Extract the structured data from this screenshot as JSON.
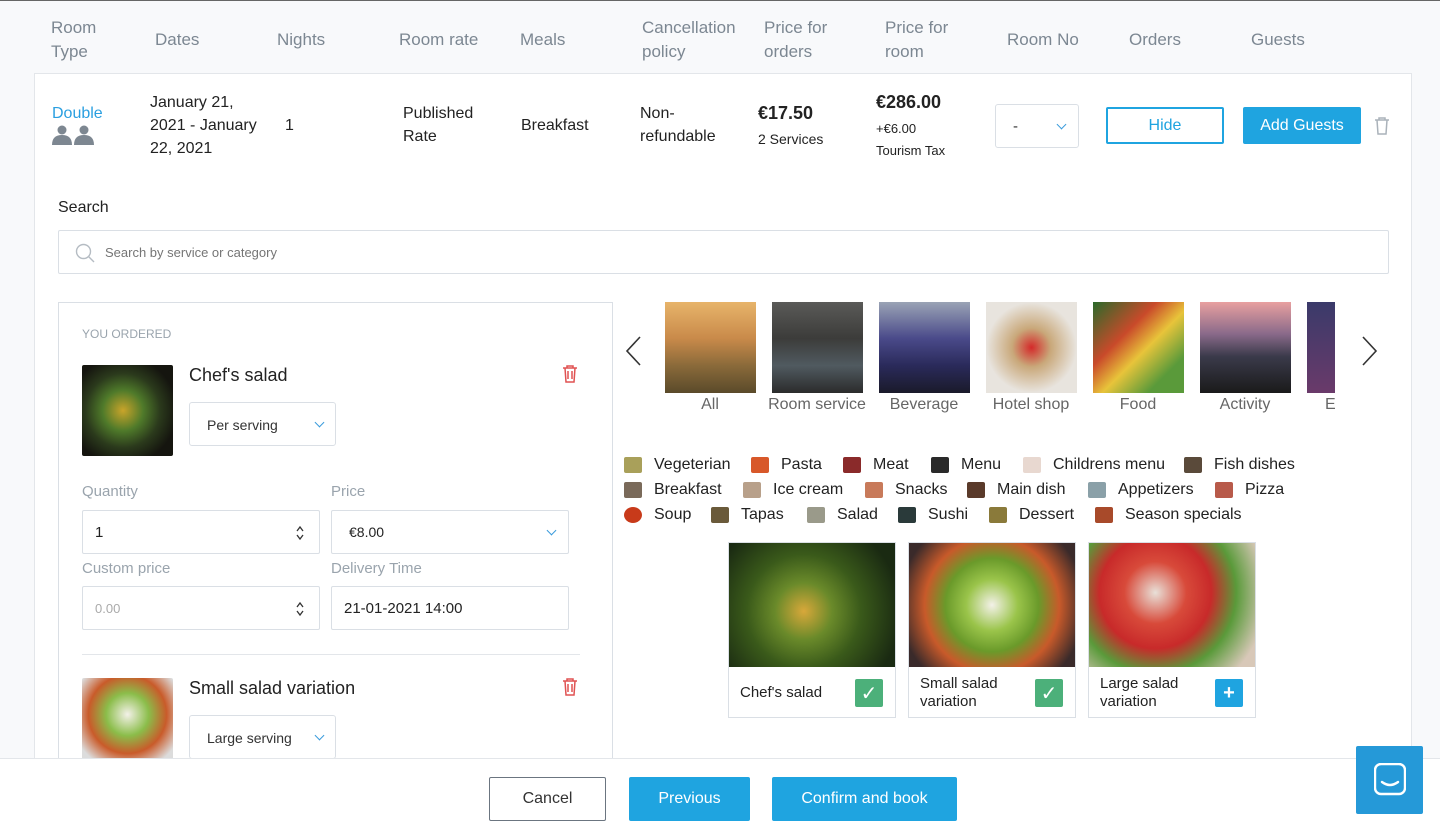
{
  "header": {
    "columns": [
      "Room\nType",
      "Dates",
      "Nights",
      "Room rate",
      "Meals",
      "Cancellation\npolicy",
      "Price for\norders",
      "Price for\nroom",
      "Room No",
      "Orders",
      "Guests"
    ]
  },
  "booking": {
    "room_type": "Double",
    "dates": "January 21,\n2021 - January\n22, 2021",
    "nights": "1",
    "room_rate": "Published\nRate",
    "meals": "Breakfast",
    "cancellation": "Non-\nrefundable",
    "orders_price": "€17.50",
    "orders_count": "2 Services",
    "room_price": "€286.00",
    "tax_amount": "+€6.00",
    "tax_label": "Tourism Tax",
    "room_no": "-",
    "hide_label": "Hide",
    "add_guests_label": "Add Guests"
  },
  "search": {
    "label": "Search",
    "placeholder": "Search by service or category"
  },
  "ordered": {
    "title": "YOU ORDERED",
    "items": [
      {
        "name": "Chef's salad",
        "serving": "Per serving",
        "quantity_label": "Quantity",
        "quantity": "1",
        "price_label": "Price",
        "price": "€8.00",
        "custom_price_label": "Custom price",
        "custom_price_placeholder": "0.00",
        "delivery_label": "Delivery Time",
        "delivery": "21-01-2021 14:00"
      },
      {
        "name": "Small salad variation",
        "serving": "Large serving"
      }
    ]
  },
  "categories": [
    "All",
    "Room\nservice",
    "Beverage",
    "Hotel shop",
    "Food",
    "Activity",
    "E"
  ],
  "tags": [
    "Vegeterian",
    "Pasta",
    "Meat",
    "Menu",
    "Childrens menu",
    "Fish dishes",
    "Breakfast",
    "Ice cream",
    "Snacks",
    "Main dish",
    "Appetizers",
    "Pizza",
    "Soup",
    "Tapas",
    "Salad",
    "Sushi",
    "Dessert",
    "Season specials"
  ],
  "products": [
    {
      "name": "Chef's salad",
      "state": "✓"
    },
    {
      "name": "Small salad\nvariation",
      "state": "✓"
    },
    {
      "name": "Large salad\nvariation",
      "state": "+"
    }
  ],
  "footer": {
    "cancel": "Cancel",
    "previous": "Previous",
    "confirm": "Confirm and book"
  },
  "colors": {
    "accent": "#1fa4e0",
    "link": "#2a9fe0",
    "check": "#4cb07a",
    "danger": "#e05252"
  }
}
